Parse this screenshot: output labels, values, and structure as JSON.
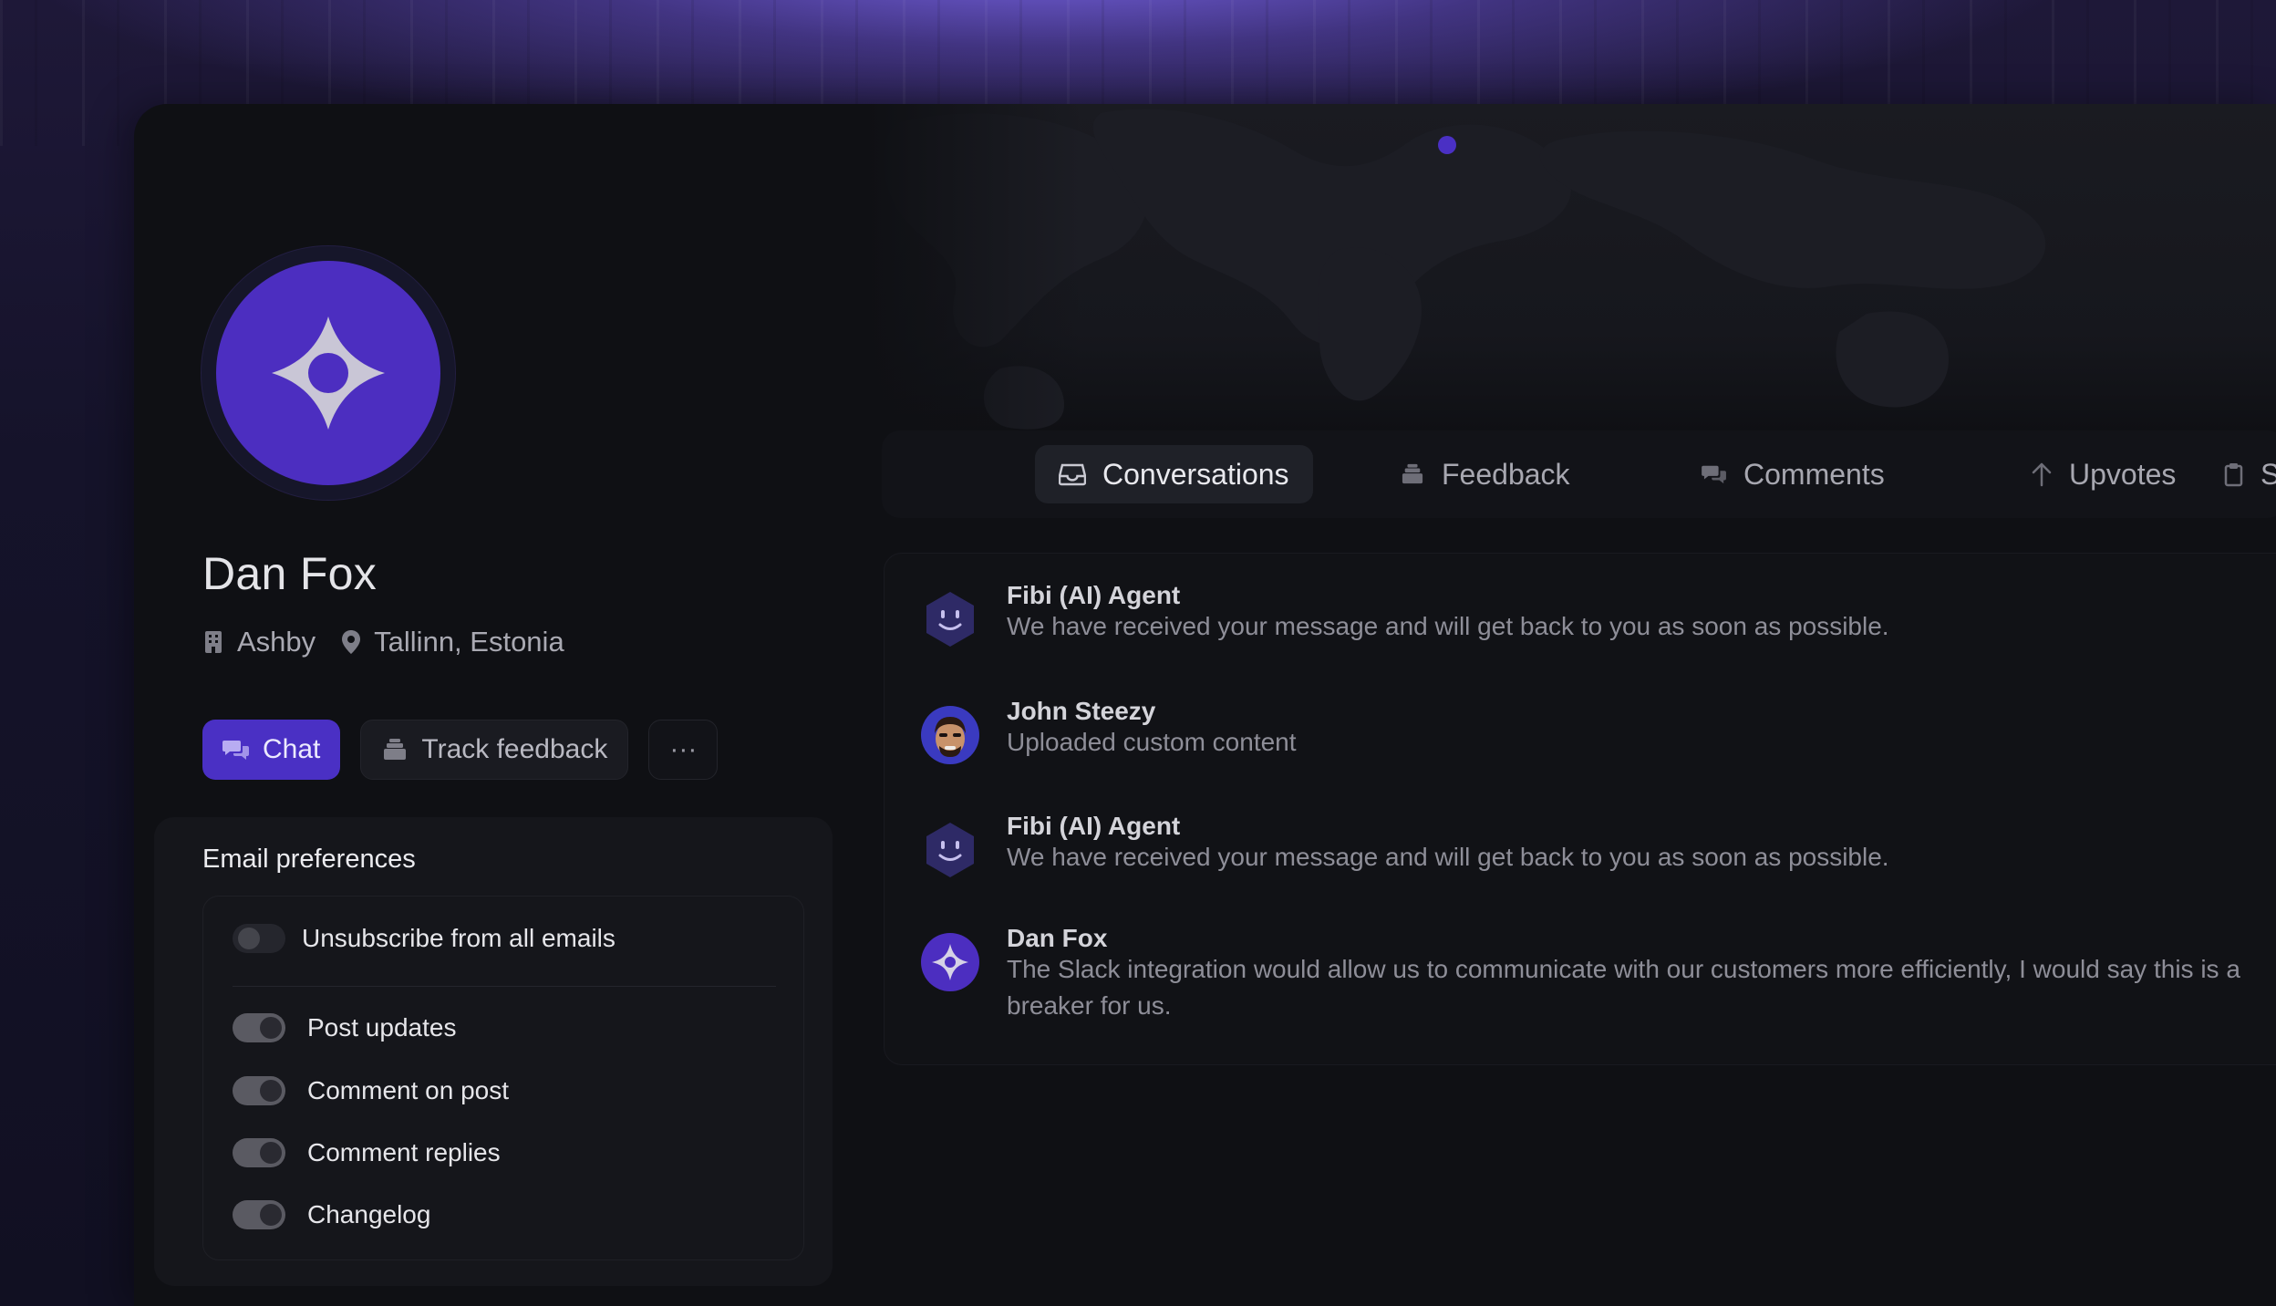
{
  "profile": {
    "name": "Dan Fox",
    "company": "Ashby",
    "location": "Tallinn, Estonia",
    "avatar_icon": "diamond-logo-icon",
    "avatar_color": "#4c2ec0"
  },
  "actions": {
    "chat_label": "Chat",
    "track_feedback_label": "Track feedback",
    "more_label": "···"
  },
  "email_preferences": {
    "title": "Email preferences",
    "unsubscribe_label": "Unsubscribe from all emails",
    "unsubscribe_on": false,
    "items": [
      {
        "label": "Post updates",
        "on": true
      },
      {
        "label": "Comment on post",
        "on": true
      },
      {
        "label": "Comment replies",
        "on": true
      },
      {
        "label": "Changelog",
        "on": true
      }
    ]
  },
  "tabs": [
    {
      "label": "Conversations",
      "icon": "inbox-icon",
      "active": true
    },
    {
      "label": "Feedback",
      "icon": "stack-icon",
      "active": false
    },
    {
      "label": "Comments",
      "icon": "chat-bubbles-icon",
      "active": false
    },
    {
      "label": "Upvotes",
      "icon": "arrow-up-icon",
      "active": false
    },
    {
      "label": "Su",
      "icon": "clipboard-icon",
      "active": false
    }
  ],
  "conversations": [
    {
      "author": "Fibi (AI) Agent",
      "text": "We have received your message and will get back to you as soon as possible.",
      "avatar": "bot-icon"
    },
    {
      "author": "John Steezy",
      "text": "Uploaded custom content",
      "avatar": "user-memoji-icon"
    },
    {
      "author": "Fibi (AI) Agent",
      "text": "We have received your message and will get back to you as soon as possible.",
      "avatar": "bot-icon"
    },
    {
      "author": "Dan Fox",
      "text": "The Slack integration would allow us to communicate with our customers more efficiently, I would say this is a breaker for us.",
      "avatar": "diamond-logo-icon"
    }
  ],
  "colors": {
    "accent": "#4a30c4",
    "panel_bg": "#0f1014"
  }
}
